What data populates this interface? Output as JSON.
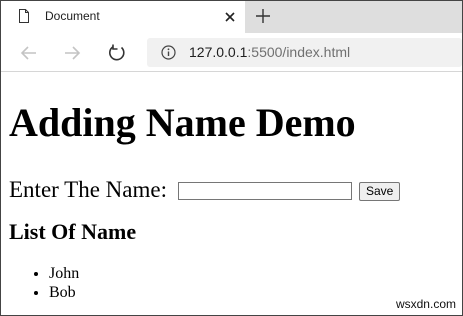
{
  "browser": {
    "tab_title": "Document",
    "url_host": "127.0.0.1",
    "url_rest": ":5500/index.html"
  },
  "page": {
    "heading": "Adding Name Demo",
    "name_label": "Enter The Name:",
    "name_input_value": "",
    "save_label": "Save",
    "list_heading": "List Of Name",
    "names": [
      "John",
      "Bob"
    ]
  },
  "watermark": "wsxdn.com",
  "icons": {
    "tab": "document-icon",
    "close": "close-icon",
    "new_tab": "plus-icon",
    "back": "arrow-left-icon",
    "forward": "arrow-right-icon",
    "reload": "reload-icon",
    "site_info": "info-icon"
  }
}
